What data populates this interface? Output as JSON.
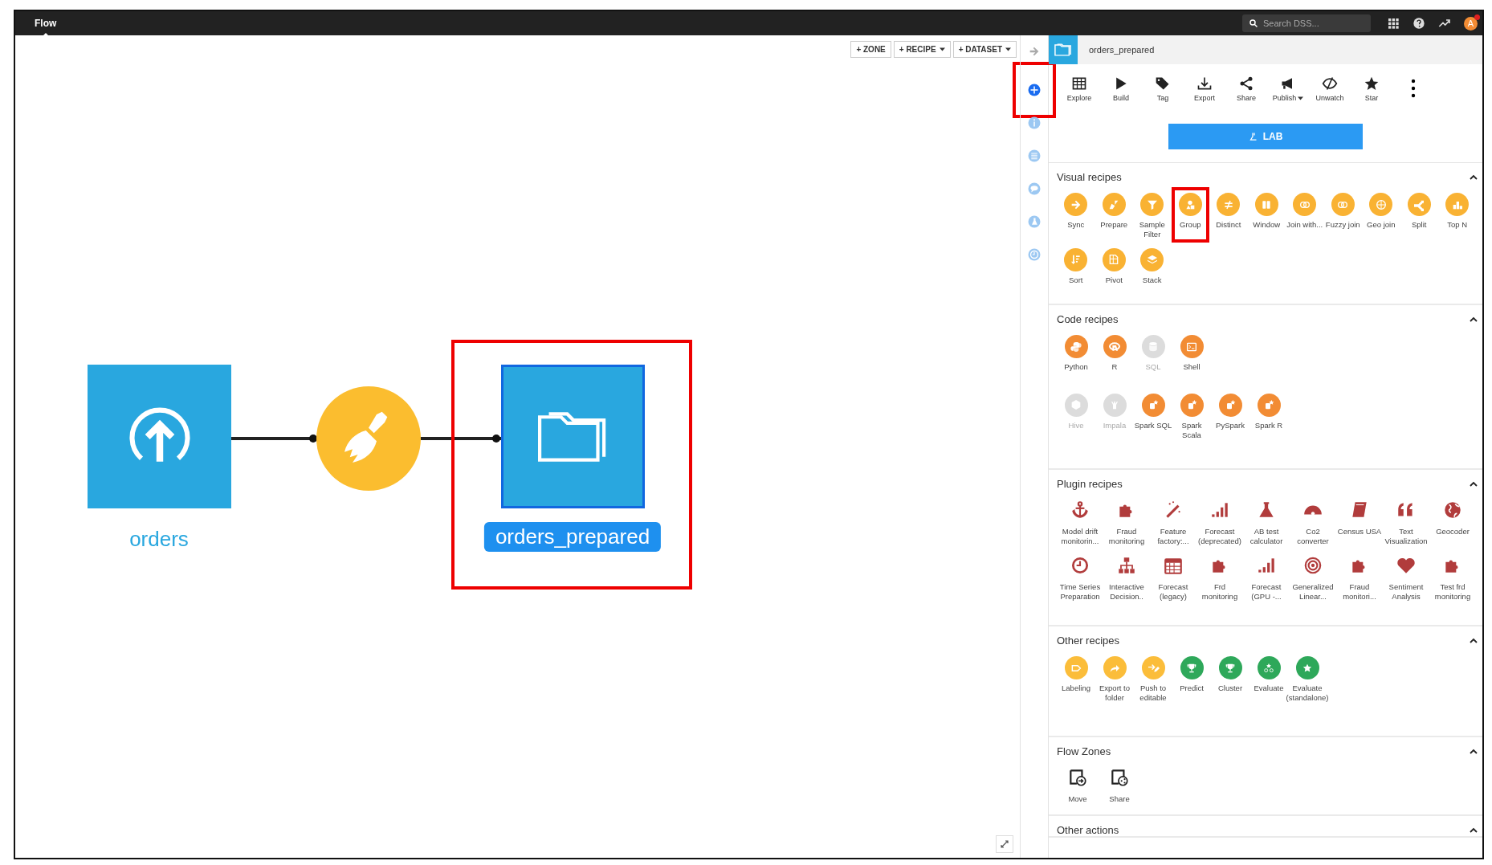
{
  "topbar": {
    "tab": "Flow",
    "search": {
      "placeholder": "Search DSS..."
    },
    "avatar": "A"
  },
  "canvas": {
    "buttons": [
      {
        "label": "+ ZONE",
        "caret": false
      },
      {
        "label": "+ RECIPE",
        "caret": true
      },
      {
        "label": "+ DATASET",
        "caret": true
      }
    ],
    "nodes": [
      {
        "kind": "dataset",
        "label": "orders",
        "selected": false,
        "highlighted": false
      },
      {
        "kind": "recipe",
        "selected": false,
        "highlighted": false
      },
      {
        "kind": "folder",
        "label": "orders_prepared",
        "selected": true,
        "highlighted": true
      }
    ]
  },
  "rail": [
    {
      "selected": true,
      "highlighted": true
    },
    {
      "selected": false,
      "highlighted": false
    },
    {
      "selected": false,
      "highlighted": false
    },
    {
      "selected": false,
      "highlighted": false
    },
    {
      "selected": false,
      "highlighted": false
    },
    {
      "selected": false,
      "highlighted": false
    }
  ],
  "panel": {
    "title": "orders_prepared",
    "actions": [
      {
        "label": "Explore",
        "caret": false
      },
      {
        "label": "Build",
        "caret": false
      },
      {
        "label": "Tag",
        "caret": false
      },
      {
        "label": "Export",
        "caret": false
      },
      {
        "label": "Share",
        "caret": false
      },
      {
        "label": "Publish",
        "caret": true
      },
      {
        "label": "Unwatch",
        "caret": false
      },
      {
        "label": "Star",
        "caret": false
      }
    ],
    "lab_button": "LAB",
    "sections": [
      {
        "title": "Visual recipes",
        "expanded": true,
        "kind": "circle",
        "groups": [
          [
            {
              "label": "Sync",
              "color": "#f9b233",
              "disabled": false,
              "highlighted": false
            },
            {
              "label": "Prepare",
              "color": "#f9b233",
              "disabled": false,
              "highlighted": false
            },
            {
              "label": "Sample Filter",
              "color": "#f9b233",
              "disabled": false,
              "highlighted": false
            },
            {
              "label": "Group",
              "color": "#f9b233",
              "disabled": false,
              "highlighted": true
            },
            {
              "label": "Distinct",
              "color": "#f9b233",
              "disabled": false,
              "highlighted": false
            },
            {
              "label": "Window",
              "color": "#f9b233",
              "disabled": false,
              "highlighted": false
            },
            {
              "label": "Join with...",
              "color": "#f9b233",
              "disabled": false,
              "highlighted": false
            },
            {
              "label": "Fuzzy join",
              "color": "#f9b233",
              "disabled": false,
              "highlighted": false
            },
            {
              "label": "Geo join",
              "color": "#f9b233",
              "disabled": false,
              "highlighted": false
            },
            {
              "label": "Split",
              "color": "#f9b233",
              "disabled": false,
              "highlighted": false
            },
            {
              "label": "Top N",
              "color": "#f9b233",
              "disabled": false,
              "highlighted": false
            },
            {
              "label": "Sort",
              "color": "#f9b233",
              "disabled": false,
              "highlighted": false
            },
            {
              "label": "Pivot",
              "color": "#f9b233",
              "disabled": false,
              "highlighted": false
            },
            {
              "label": "Stack",
              "color": "#f9b233",
              "disabled": false,
              "highlighted": false
            }
          ]
        ]
      },
      {
        "title": "Code recipes",
        "expanded": true,
        "kind": "circle",
        "groups": [
          [
            {
              "label": "Python",
              "color": "#f28c34",
              "disabled": false,
              "highlighted": false
            },
            {
              "label": "R",
              "color": "#f28c34",
              "disabled": false,
              "highlighted": false
            },
            {
              "label": "SQL",
              "color": "#dcdcdc",
              "disabled": true,
              "highlighted": false
            },
            {
              "label": "Shell",
              "color": "#f28c34",
              "disabled": false,
              "highlighted": false
            }
          ],
          [
            {
              "label": "Hive",
              "color": "#dcdcdc",
              "disabled": true,
              "highlighted": false
            },
            {
              "label": "Impala",
              "color": "#dcdcdc",
              "disabled": true,
              "highlighted": false
            },
            {
              "label": "Spark SQL",
              "color": "#f28c34",
              "disabled": false,
              "highlighted": false
            },
            {
              "label": "Spark Scala",
              "color": "#f28c34",
              "disabled": false,
              "highlighted": false
            },
            {
              "label": "PySpark",
              "color": "#f28c34",
              "disabled": false,
              "highlighted": false
            },
            {
              "label": "Spark R",
              "color": "#f28c34",
              "disabled": false,
              "highlighted": false
            }
          ]
        ]
      },
      {
        "title": "Plugin recipes",
        "expanded": true,
        "kind": "plain",
        "groups": [
          [
            {
              "label": "Model drift monitorin...",
              "color": "#b13c3c",
              "disabled": false,
              "highlighted": false
            },
            {
              "label": "Fraud monitoring",
              "color": "#b13c3c",
              "disabled": false,
              "highlighted": false
            },
            {
              "label": "Feature factory:...",
              "color": "#b13c3c",
              "disabled": false,
              "highlighted": false
            },
            {
              "label": "Forecast (deprecated)",
              "color": "#b13c3c",
              "disabled": false,
              "highlighted": false
            },
            {
              "label": "AB test calculator",
              "color": "#b13c3c",
              "disabled": false,
              "highlighted": false
            },
            {
              "label": "Co2 converter",
              "color": "#b13c3c",
              "disabled": false,
              "highlighted": false
            },
            {
              "label": "Census USA",
              "color": "#b13c3c",
              "disabled": false,
              "highlighted": false
            },
            {
              "label": "Text Visualization",
              "color": "#b13c3c",
              "disabled": false,
              "highlighted": false
            },
            {
              "label": "Geocoder",
              "color": "#b13c3c",
              "disabled": false,
              "highlighted": false
            },
            {
              "label": "Time Series Preparation",
              "color": "#b13c3c",
              "disabled": false,
              "highlighted": false
            },
            {
              "label": "Interactive Decision..",
              "color": "#b13c3c",
              "disabled": false,
              "highlighted": false
            },
            {
              "label": "Forecast (legacy)",
              "color": "#b13c3c",
              "disabled": false,
              "highlighted": false
            },
            {
              "label": "Frd monitoring",
              "color": "#b13c3c",
              "disabled": false,
              "highlighted": false
            },
            {
              "label": "Forecast (GPU -...",
              "color": "#b13c3c",
              "disabled": false,
              "highlighted": false
            },
            {
              "label": "Generalized Linear...",
              "color": "#b13c3c",
              "disabled": false,
              "highlighted": false
            },
            {
              "label": "Fraud monitori...",
              "color": "#b13c3c",
              "disabled": false,
              "highlighted": false
            },
            {
              "label": "Sentiment Analysis",
              "color": "#b13c3c",
              "disabled": false,
              "highlighted": false
            },
            {
              "label": "Test frd monitoring",
              "color": "#b13c3c",
              "disabled": false,
              "highlighted": false
            }
          ]
        ]
      },
      {
        "title": "Other recipes",
        "expanded": true,
        "kind": "circle",
        "groups": [
          [
            {
              "label": "Labeling",
              "color": "#fbbd3a",
              "disabled": false,
              "highlighted": false
            },
            {
              "label": "Export to folder",
              "color": "#fbbd3a",
              "disabled": false,
              "highlighted": false
            },
            {
              "label": "Push to editable",
              "color": "#fbbd3a",
              "disabled": false,
              "highlighted": false
            },
            {
              "label": "Predict",
              "color": "#2ea85a",
              "disabled": false,
              "highlighted": false
            },
            {
              "label": "Cluster",
              "color": "#2ea85a",
              "disabled": false,
              "highlighted": false
            },
            {
              "label": "Evaluate",
              "color": "#2ea85a",
              "disabled": false,
              "highlighted": false
            },
            {
              "label": "Evaluate (standalone)",
              "color": "#2ea85a",
              "disabled": false,
              "highlighted": false
            }
          ]
        ]
      },
      {
        "title": "Flow Zones",
        "expanded": true,
        "kind": "outline",
        "groups": [
          [
            {
              "label": "Move",
              "color": "#222222",
              "disabled": false,
              "highlighted": false
            },
            {
              "label": "Share",
              "color": "#222222",
              "disabled": false,
              "highlighted": false
            }
          ]
        ]
      },
      {
        "title": "Other actions",
        "expanded": true
      }
    ]
  }
}
